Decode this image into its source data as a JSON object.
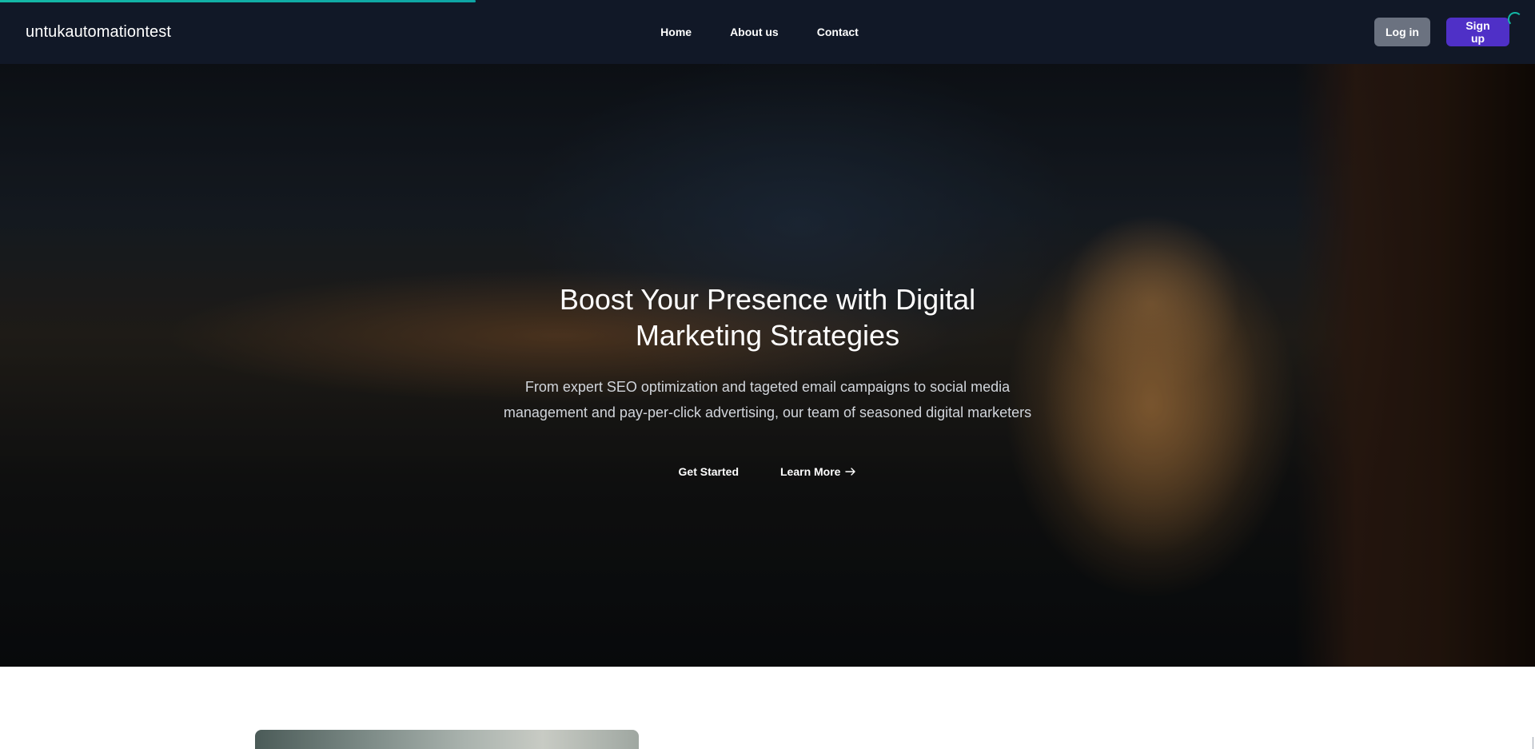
{
  "page": {
    "loading_progress_percent": 31,
    "spinner_icon": "loading-spinner-icon"
  },
  "navbar": {
    "brand": "untukautomationtest",
    "links": [
      {
        "label": "Home"
      },
      {
        "label": "About us"
      },
      {
        "label": "Contact"
      }
    ],
    "login_label": "Log in",
    "signup_label": "Sign up",
    "colors": {
      "background": "#111827",
      "login_button": "#6b7280",
      "signup_button": "#4f30c7",
      "progress": "#14b8a6"
    }
  },
  "hero": {
    "title": "Boost Your Presence with Digital Marketing Strategies",
    "description": "From expert SEO optimization and tageted email campaigns to social media management and pay-per-click advertising, our team of seasoned digital marketers",
    "primary_action": "Get Started",
    "secondary_action": "Learn More",
    "secondary_icon": "arrow-right-icon"
  }
}
